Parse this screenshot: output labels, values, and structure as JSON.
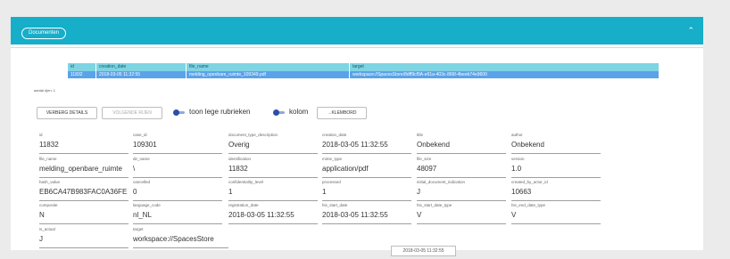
{
  "header": {
    "section_label": "Documenten"
  },
  "results": {
    "columns": [
      "id",
      "creation_date",
      "file_name",
      "target"
    ],
    "row": [
      "11832",
      "2018-03-05 11:32:55",
      "melding_openbare_ruimte_109349.pdf",
      "workspace://SpacesStore/8dff9cf9A-e61a-403c-866f-4beeb74e9600"
    ],
    "rows_label": "aantal rijen: 1"
  },
  "toolbar": {
    "hide_details": "VERBERG DETAILS",
    "next_rows": "VOLGENDE RIJEN",
    "show_empty": "toon lege rubrieken",
    "column": "kolom",
    "clipboard": "→KLEMBORD"
  },
  "details": {
    "id": {
      "label": "id",
      "value": "11832"
    },
    "case_id": {
      "label": "case_id",
      "value": "109301"
    },
    "document_type_description": {
      "label": "document_type_description",
      "value": "Overig"
    },
    "creation_date": {
      "label": "creation_date",
      "value": "2018-03-05 11:32:55"
    },
    "title": {
      "label": "title",
      "value": "Onbekend"
    },
    "author": {
      "label": "author",
      "value": "Onbekend"
    },
    "file_name": {
      "label": "file_name",
      "value": "melding_openbare_ruimte"
    },
    "dir_name": {
      "label": "dir_name",
      "value": "\\"
    },
    "identification": {
      "label": "identification",
      "value": "11832"
    },
    "mime_type": {
      "label": "mime_type",
      "value": "application/pdf"
    },
    "file_size": {
      "label": "file_size",
      "value": "48097"
    },
    "version": {
      "label": "version",
      "value": "1.0"
    },
    "hash_value": {
      "label": "hash_value",
      "value": "EB6CA47B983FAC0A36FE"
    },
    "cancelled": {
      "label": "cancelled",
      "value": "0"
    },
    "confidentiality_level": {
      "label": "confidentiality_level",
      "value": "1"
    },
    "processed": {
      "label": "processed",
      "value": "1"
    },
    "initial_document_indication": {
      "label": "initial_document_indication",
      "value": "J"
    },
    "created_by_actor_id": {
      "label": "created_by_actor_id",
      "value": "10663"
    },
    "composite": {
      "label": "composite",
      "value": "N"
    },
    "language_code": {
      "label": "language_code",
      "value": "nl_NL"
    },
    "registration_date": {
      "label": "registration_date",
      "value": "2018-03-05 11:32:55"
    },
    "his_start_date": {
      "label": "his_start_date",
      "value": "2018-03-05 11:32:55"
    },
    "his_start_date_type": {
      "label": "his_start_date_type",
      "value": "V"
    },
    "his_end_date_type": {
      "label": "his_end_date_type",
      "value": "V"
    },
    "is_actual": {
      "label": "is_actual",
      "value": "J"
    },
    "target": {
      "label": "target",
      "value": "workspace://SpacesStore"
    }
  },
  "tooltip": "2018-03-05 11:32:55",
  "colors": {
    "header": "#16aec9",
    "table_header": "#7fd4e3",
    "selected_row": "#5aa2ea",
    "toggle": "#2b4ea8"
  }
}
